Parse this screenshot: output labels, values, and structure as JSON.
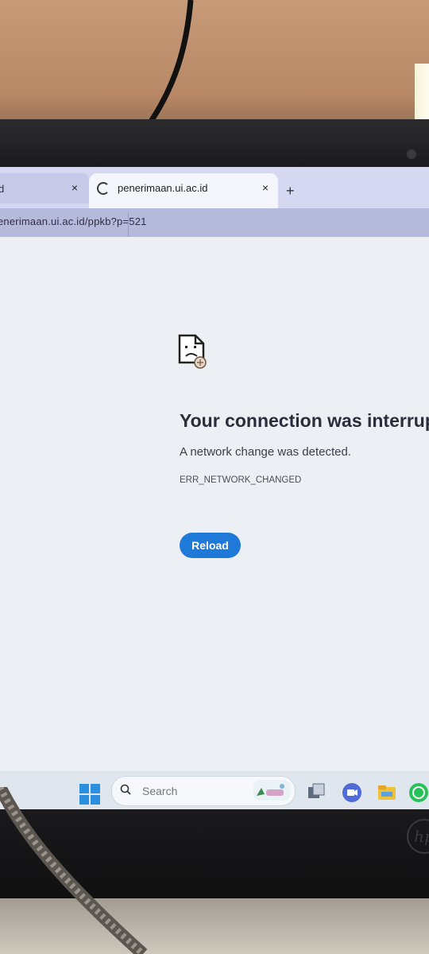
{
  "browser": {
    "tabs": [
      {
        "label": "d",
        "state": "inactive"
      },
      {
        "label": "penerimaan.ui.ac.id",
        "state": "loading"
      }
    ],
    "close_glyph": "×",
    "new_tab_glyph": "+",
    "url": "enerimaan.ui.ac.id/ppkb?p=521"
  },
  "error_page": {
    "heading": "Your connection was interrup",
    "message": "A network change was detected.",
    "error_code": "ERR_NETWORK_CHANGED",
    "reload_label": "Reload",
    "accent_color": "#1f79d8"
  },
  "taskbar": {
    "search_placeholder": "Search",
    "icons": [
      "windows-start-icon",
      "search-icon",
      "task-view-icon",
      "meet-icon",
      "file-explorer-icon",
      "whatsapp-icon"
    ]
  },
  "device": {
    "brand_logo": "hp"
  }
}
